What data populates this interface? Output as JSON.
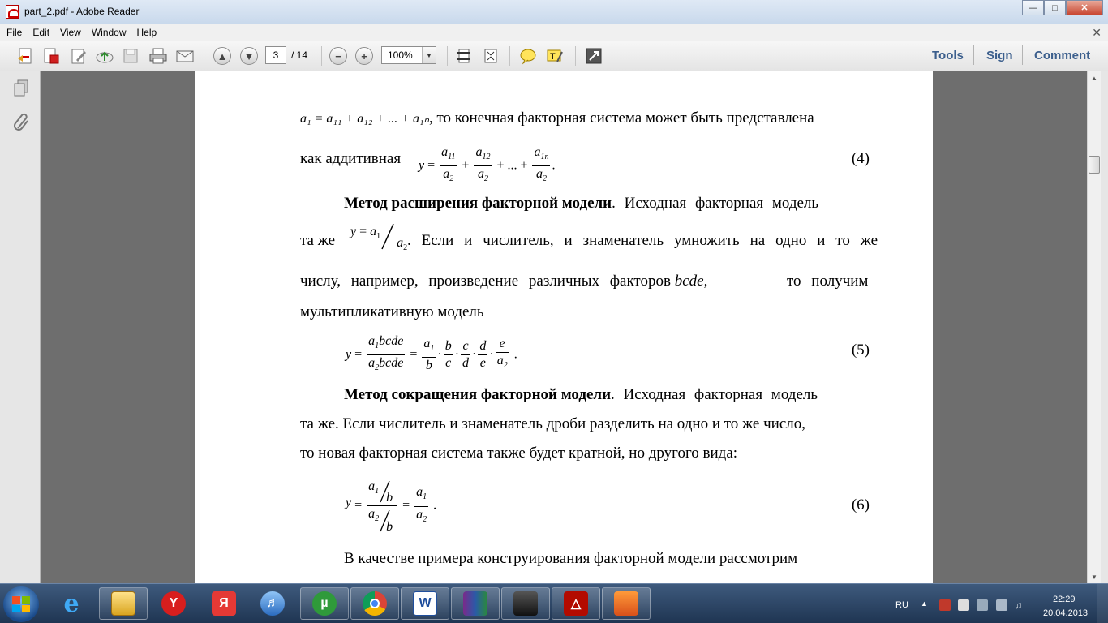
{
  "window": {
    "title": "part_2.pdf - Adobe Reader"
  },
  "menu": [
    "File",
    "Edit",
    "View",
    "Window",
    "Help"
  ],
  "toolbar": {
    "page_current": "3",
    "page_total": "/ 14",
    "zoom": "100%",
    "tools_label": "Tools",
    "sign_label": "Sign",
    "comment_label": "Comment"
  },
  "document": {
    "line1": {
      "math": "a₁ = a₁₁ + a₁₂ + ... + a₁ₙ",
      "text": ", то конечная факторная система может быть представлена"
    },
    "line2": {
      "text": "как аддитивная",
      "formula": "y = a11/a2 + a12/a2 + ... + a1n/a2 .",
      "eq_number": "(4)"
    },
    "para1": {
      "bold": "Метод расширения факторной модели",
      "rest": ". Исходная факторная модель",
      "line2_start": "та же",
      "line2_formula": "y = a1/a2",
      "line2_rest": ". Если и числитель, и знаменатель умножить на одно и то же",
      "line3_start": "числу, например, произведение различных факторов",
      "line3_italic": "bcde,",
      "line3_rest": "то получим",
      "line4": "мультипликативную модель"
    },
    "eq5": {
      "formula": "y = a1bcde/a2bcde = a1/b · b/c · c/d · d/e · e/a2 .",
      "eq_number": "(5)"
    },
    "para2": {
      "bold": "Метод сокращения факторной модели",
      "rest": ". Исходная факторная модель",
      "line2": "та же. Если числитель и знаменатель дроби разделить на одно и то же число,",
      "line3": "то новая факторная система также будет кратной, но другого вида:"
    },
    "eq6": {
      "formula": "y = (a1/b)/(a2/b) = a1/a2 .",
      "eq_number": "(6)"
    },
    "para3": {
      "text": "В качестве примера конструирования факторной модели рассмотрим"
    }
  },
  "taskbar": {
    "language": "RU",
    "time": "22:29",
    "date": "20.04.2013"
  },
  "colors": {
    "link_blue": "#3c5f8d",
    "doc_bg": "#6e6e6e",
    "taskbar": "#2b4566"
  }
}
